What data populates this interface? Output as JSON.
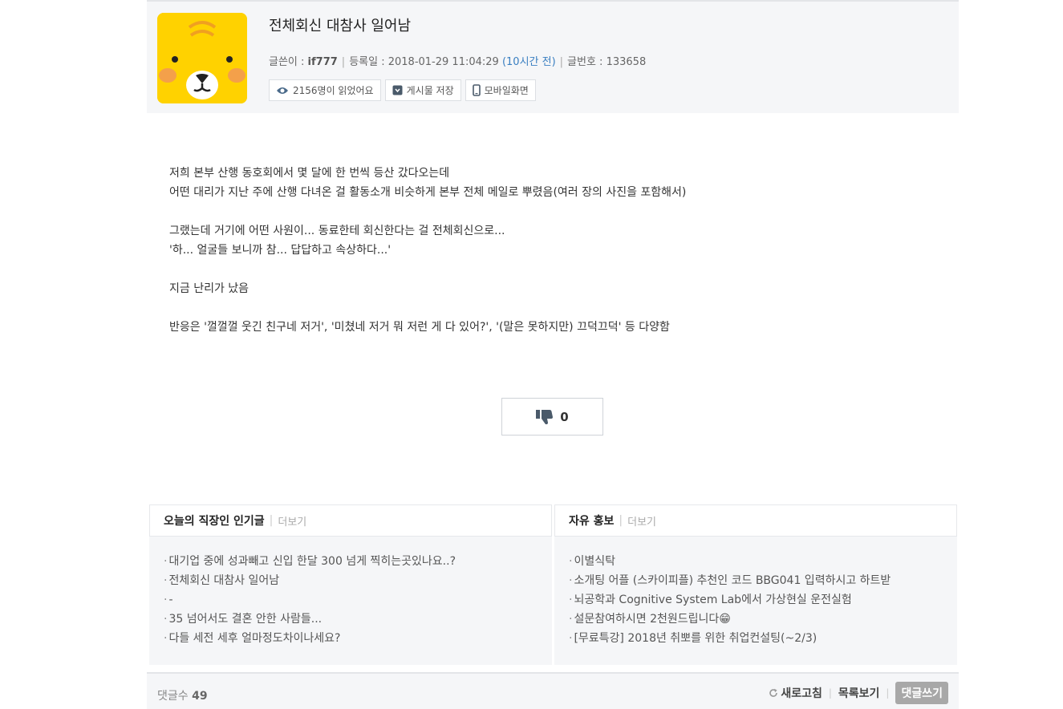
{
  "post": {
    "title": "전체회신 대참사 일어남",
    "author_label": "글쓴이 :",
    "author": "if777",
    "date_label": "등록일 :",
    "date": "2018-01-29 11:04:29",
    "ago": "(10시간 전)",
    "number_label": "글번호 :",
    "number": "133658",
    "views_label": "2156명이 읽었어요",
    "save_label": "게시물 저장",
    "mobile_label": "모바일화면"
  },
  "body": {
    "lines": [
      "저희 본부 산행 동호회에서 몇 달에 한 번씩 등산 갔다오는데",
      "어떤 대리가 지난 주에 산행 다녀온 걸 활동소개 비슷하게 본부 전체 메일로 뿌렸음(여러 장의 사진을 포함해서)",
      "",
      "그랬는데 거기에 어떤 사원이... 동료한테 회신한다는 걸 전체회신으로...",
      "'하... 얼굴들 보니까 참... 답답하고 속상하다...'",
      "",
      "지금 난리가 났음",
      "",
      "반응은 '껄껄껄 웃긴 친구네 저거', '미쳤네 저거 뭐 저런 게 다 있어?', '(말은 못하지만) 끄덕끄덕' 등 다양함"
    ]
  },
  "dislike": {
    "count": "0"
  },
  "popular": {
    "title": "오늘의 직장인 인기글",
    "more": "더보기",
    "items": [
      "대기업 중에 성과빼고 신입 한달 300 넘게 찍히는곳있나요..?",
      "전체회신 대참사 일어남",
      "-",
      "35 넘어서도 결혼 안한 사람들...",
      "다들 세전 세후 얼마정도차이나세요?"
    ]
  },
  "promo": {
    "title": "자유 홍보",
    "more": "더보기",
    "items": [
      "이별식탁",
      "소개팅 어플 (스카이피플) 추천인 코드 BBG041 입력하시고 하트받",
      "뇌공학과 Cognitive System Lab에서 가상현실 운전실험",
      "설문참여하시면 2천원드립니다😁",
      "[무료특강] 2018년 취뽀를 위한 취업컨설팅(~2/3)"
    ]
  },
  "footer": {
    "comment_label": "댓글수",
    "comment_count": "49",
    "refresh": "새로고침",
    "list": "목록보기",
    "write": "댓글쓰기"
  },
  "colors": {
    "accent_link": "#3a7fc1",
    "avatar_bg": "#ffd200",
    "panel_bg": "#f5f6f8"
  }
}
